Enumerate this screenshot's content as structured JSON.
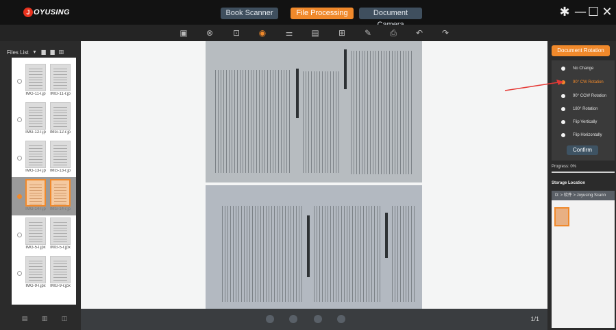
{
  "brand": {
    "logo_mark": "J",
    "logo_word": "OYUSING"
  },
  "modes": [
    {
      "label": "Book Scanner",
      "active": false
    },
    {
      "label": "File Processing",
      "active": true
    },
    {
      "label": "Document Camera",
      "active": false
    }
  ],
  "window_controls": {
    "settings": "✱",
    "minimize": "—",
    "maximize": "☐",
    "close": "✕"
  },
  "toolbar": {
    "icons": [
      "save-icon",
      "merge-icon",
      "crop-icon",
      "rotate-icon",
      "adjust-icon",
      "pdf-icon",
      "ocr-icon",
      "edit-icon",
      "print-icon",
      "undo-icon",
      "redo-icon"
    ],
    "glyphs": [
      "▣",
      "⊗",
      "⊡",
      "◉",
      "⚌",
      "▤",
      "⊞",
      "✎",
      "⎙",
      "↶",
      "↷"
    ]
  },
  "files": {
    "header_label": "Files List",
    "rows": [
      {
        "names": [
          "IMG-11-l.jp",
          "IMG-11-r.jp"
        ],
        "selected": false
      },
      {
        "names": [
          "IMG-12-l.jp",
          "IMG-12-r.jp"
        ],
        "selected": false
      },
      {
        "names": [
          "IMG-13-l.jp",
          "IMG-13-r.jp"
        ],
        "selected": false
      },
      {
        "names": [
          "IMG-14-l.jp",
          "IMG-14-r.jp"
        ],
        "selected": true
      },
      {
        "names": [
          "IMG-5-l.jpx",
          "IMG-5-r.jpx"
        ],
        "selected": false
      },
      {
        "names": [
          "IMG-9-l.jpx",
          "IMG-9-r.jpx"
        ],
        "selected": false
      }
    ]
  },
  "viewer": {
    "page_count": "1/1"
  },
  "rotation": {
    "title": "Document Rotation",
    "options": [
      {
        "label": "No Change",
        "selected": false
      },
      {
        "label": "90° CW Rotation",
        "selected": true
      },
      {
        "label": "90° CCW Rotation",
        "selected": false
      },
      {
        "label": "180° Rotation",
        "selected": false
      },
      {
        "label": "Flip Vertically",
        "selected": false
      },
      {
        "label": "Flip Horizontally",
        "selected": false
      }
    ],
    "confirm_label": "Confirm"
  },
  "progress": {
    "label": "Progress: 0%",
    "value": 0
  },
  "storage": {
    "title": "Storage Location",
    "path": "D: > 软件 > Joyusing Scann"
  },
  "colors": {
    "accent": "#f0892b",
    "annotation": "#e53935"
  }
}
